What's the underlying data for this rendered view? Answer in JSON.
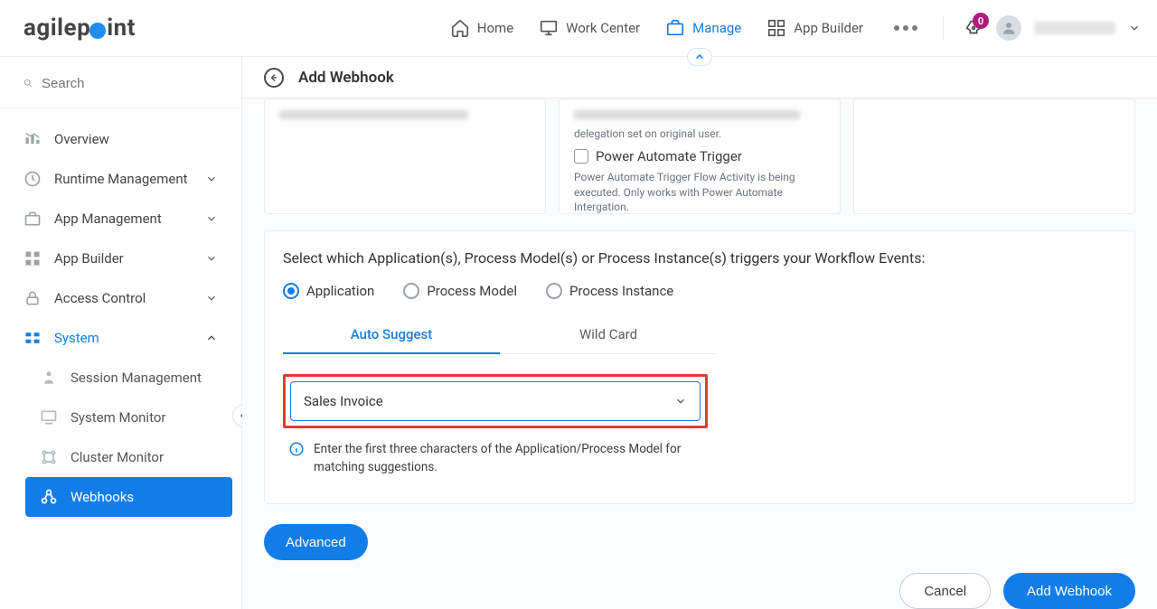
{
  "logo_text": "agilep int",
  "topnav": {
    "home": "Home",
    "work_center": "Work Center",
    "manage": "Manage",
    "app_builder": "App Builder"
  },
  "notification_count": "0",
  "search": {
    "placeholder": "Search"
  },
  "sidebar": {
    "items": [
      {
        "label": "Overview"
      },
      {
        "label": "Runtime Management"
      },
      {
        "label": "App Management"
      },
      {
        "label": "App Builder"
      },
      {
        "label": "Access Control"
      },
      {
        "label": "System"
      }
    ],
    "system_sub": [
      {
        "label": "Session Management"
      },
      {
        "label": "System Monitor"
      },
      {
        "label": "Cluster Monitor"
      },
      {
        "label": "Webhooks"
      }
    ]
  },
  "page": {
    "title": "Add Webhook"
  },
  "cards": {
    "card2_delegation": "delegation set on original user.",
    "card2_check_label": "Power Automate Trigger",
    "card2_check_desc": "Power Automate Trigger Flow Activity is being executed. Only works with Power Automate Intergation."
  },
  "panel": {
    "title": "Select which Application(s), Process Model(s) or Process Instance(s) triggers your Workflow Events:",
    "radio_app": "Application",
    "radio_model": "Process Model",
    "radio_instance": "Process Instance",
    "tab_auto": "Auto Suggest",
    "tab_wild": "Wild Card",
    "dropdown_value": "Sales Invoice",
    "hint": "Enter the first three characters of the Application/Process Model for matching suggestions."
  },
  "buttons": {
    "advanced": "Advanced",
    "cancel": "Cancel",
    "add": "Add Webhook"
  }
}
